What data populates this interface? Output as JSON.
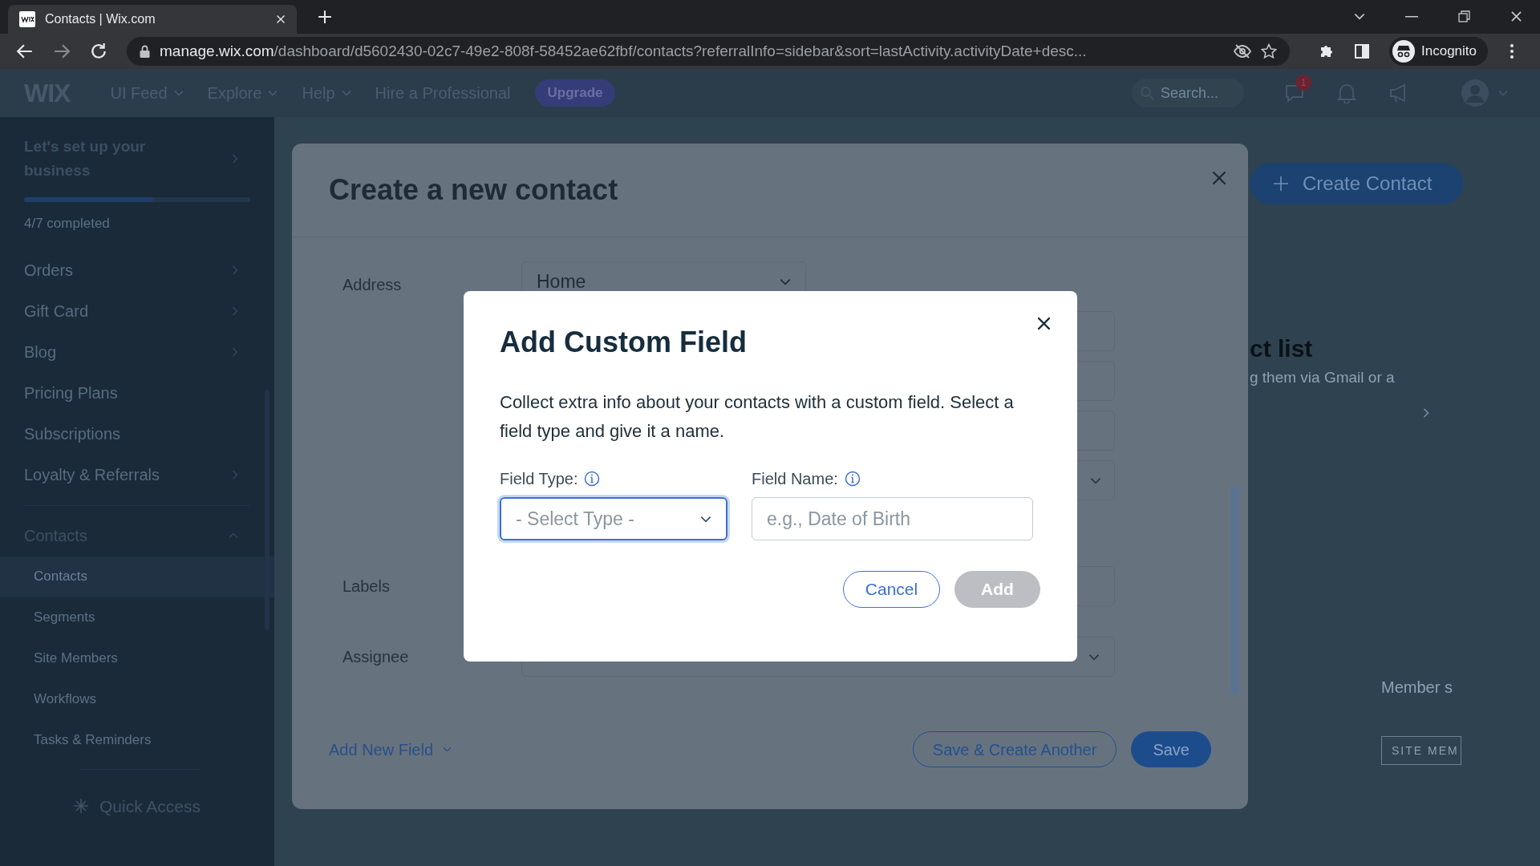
{
  "browser": {
    "tab_title": "Contacts | Wix.com",
    "url_host": "manage.wix.com",
    "url_path": "/dashboard/d5602430-02c7-49e2-808f-58452ae62fbf/contacts?referralInfo=sidebar&sort=lastActivity.activityDate+desc...",
    "profile": "Incognito"
  },
  "topbar": {
    "logo": "WIX",
    "nav": [
      {
        "label": "UI Feed",
        "dropdown": true
      },
      {
        "label": "Explore",
        "dropdown": true
      },
      {
        "label": "Help",
        "dropdown": true
      },
      {
        "label": "Hire a Professional",
        "dropdown": false
      }
    ],
    "upgrade": "Upgrade",
    "search_placeholder": "Search...",
    "notification_count": "1"
  },
  "sidebar": {
    "setup": {
      "title": "Let's set up your business",
      "level": 0.57,
      "status": "4/7 completed"
    },
    "items": [
      {
        "label": "Orders",
        "chevron": true
      },
      {
        "label": "Gift Card",
        "chevron": true
      },
      {
        "label": "Blog",
        "chevron": true
      },
      {
        "label": "Pricing Plans",
        "chevron": false
      },
      {
        "label": "Subscriptions",
        "chevron": false
      },
      {
        "label": "Loyalty & Referrals",
        "chevron": true
      }
    ],
    "section": {
      "label": "Contacts",
      "expanded": true,
      "children": [
        {
          "label": "Contacts",
          "selected": true
        },
        {
          "label": "Segments",
          "selected": false
        },
        {
          "label": "Site Members",
          "selected": false
        },
        {
          "label": "Workflows",
          "selected": false
        },
        {
          "label": "Tasks & Reminders",
          "selected": false
        }
      ]
    },
    "quick_access": "Quick Access"
  },
  "background": {
    "create_button": "Create Contact",
    "heading": "ct list",
    "text": "g them via Gmail or a",
    "column": "Member s",
    "tag": "SITE MEM"
  },
  "contact_panel": {
    "title": "Create a new contact",
    "address": {
      "label": "Address",
      "value": "Home"
    },
    "labels_label": "Labels",
    "assignee": {
      "label": "Assignee"
    },
    "add_field": "Add New Field",
    "save_another": "Save & Create Another",
    "save": "Save"
  },
  "custom_field_dialog": {
    "title": "Add Custom Field",
    "description": "Collect extra info about your contacts with a custom field. Select a field type and give it a name.",
    "field_type": {
      "label": "Field Type:",
      "placeholder": "- Select Type -",
      "focused": true
    },
    "field_name": {
      "label": "Field Name:",
      "placeholder": "e.g., Date of Birth",
      "focused": false
    },
    "cancel": "Cancel",
    "add": {
      "label": "Add",
      "disabled": true
    }
  }
}
